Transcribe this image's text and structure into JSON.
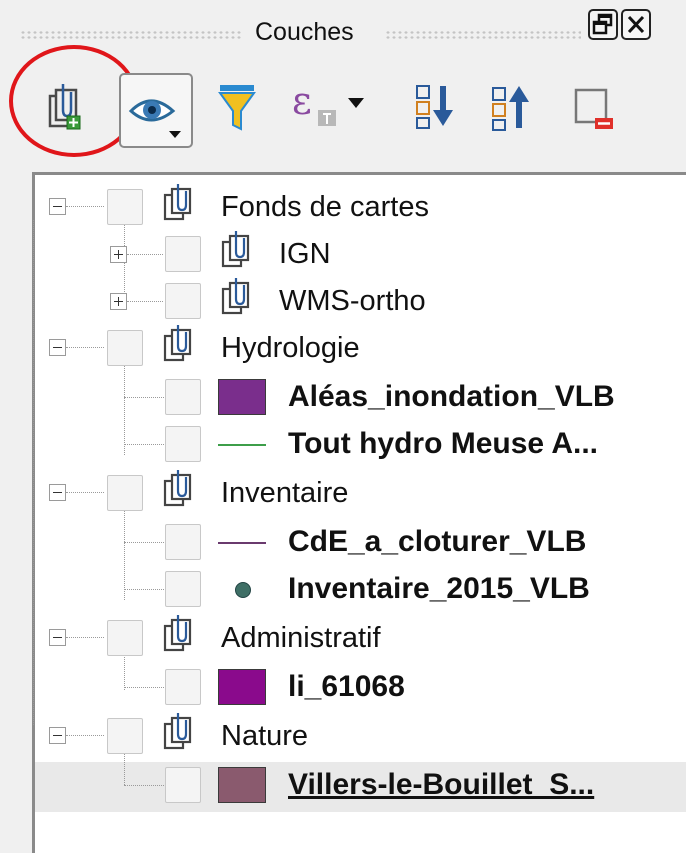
{
  "panel": {
    "title": "Couches"
  },
  "toolbar": {
    "buttons": [
      {
        "name": "add-group-button",
        "icon": "add-group-icon"
      },
      {
        "name": "manage-visibility-button",
        "icon": "eye-icon"
      },
      {
        "name": "filter-legend-button",
        "icon": "filter-icon"
      },
      {
        "name": "filter-by-expression-button",
        "icon": "expression-icon"
      },
      {
        "name": "expand-all-button",
        "icon": "expand-all-icon"
      },
      {
        "name": "collapse-all-button",
        "icon": "collapse-all-icon"
      },
      {
        "name": "remove-layer-button",
        "icon": "remove-layer-icon"
      }
    ]
  },
  "layers": [
    {
      "label": "Fonds de cartes",
      "kind": "group"
    },
    {
      "label": "IGN",
      "kind": "group"
    },
    {
      "label": "WMS-ortho",
      "kind": "group"
    },
    {
      "label": "Hydrologie",
      "kind": "group"
    },
    {
      "label": "Aléas_inondation_VLB",
      "kind": "polygon",
      "color": "#7a2e8c"
    },
    {
      "label": "Tout hydro Meuse A...",
      "kind": "line",
      "color": "#3d9e4a"
    },
    {
      "label": "Inventaire",
      "kind": "group"
    },
    {
      "label": "CdE_a_cloturer_VLB",
      "kind": "line",
      "color": "#6a3a6e"
    },
    {
      "label": "Inventaire_2015_VLB",
      "kind": "point",
      "color": "#3f6f66"
    },
    {
      "label": "Administratif",
      "kind": "group"
    },
    {
      "label": "li_61068",
      "kind": "polygon",
      "color": "#8a0a8c"
    },
    {
      "label": "Nature",
      "kind": "group"
    },
    {
      "label": "Villers-le-Bouillet_S...",
      "kind": "polygon",
      "color": "#8a5a6e"
    }
  ]
}
